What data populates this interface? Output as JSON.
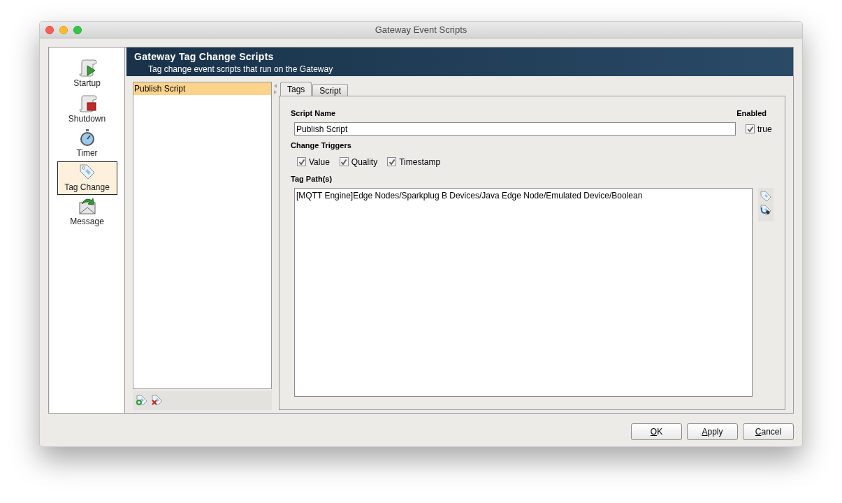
{
  "window": {
    "title": "Gateway Event Scripts"
  },
  "nav": [
    {
      "label": "Startup",
      "kind": "startup",
      "selected": false
    },
    {
      "label": "Shutdown",
      "kind": "shutdown",
      "selected": false
    },
    {
      "label": "Timer",
      "kind": "timer",
      "selected": false
    },
    {
      "label": "Tag Change",
      "kind": "tag",
      "selected": true
    },
    {
      "label": "Message",
      "kind": "message",
      "selected": false
    }
  ],
  "header": {
    "title": "Gateway Tag Change Scripts",
    "subtitle": "Tag change event scripts that run on the Gateway"
  },
  "scripts": [
    {
      "label": "Publish Script",
      "selected": true
    }
  ],
  "tabs": [
    {
      "label": "Tags",
      "selected": true
    },
    {
      "label": "Script",
      "selected": false
    }
  ],
  "form": {
    "script_name_label": "Script Name",
    "script_name": "Publish Script",
    "enabled_label": "Enabled",
    "enabled": {
      "label": "true",
      "checked": true
    },
    "triggers_label": "Change Triggers",
    "triggers": [
      {
        "label": "Value",
        "checked": true
      },
      {
        "label": "Quality",
        "checked": true
      },
      {
        "label": "Timestamp",
        "checked": true
      }
    ],
    "tag_paths_label": "Tag Path(s)",
    "tag_paths": "[MQTT Engine]Edge Nodes/Sparkplug B Devices/Java Edge Node/Emulated Device/Boolean"
  },
  "buttons": [
    "OK",
    "Apply",
    "Cancel"
  ]
}
